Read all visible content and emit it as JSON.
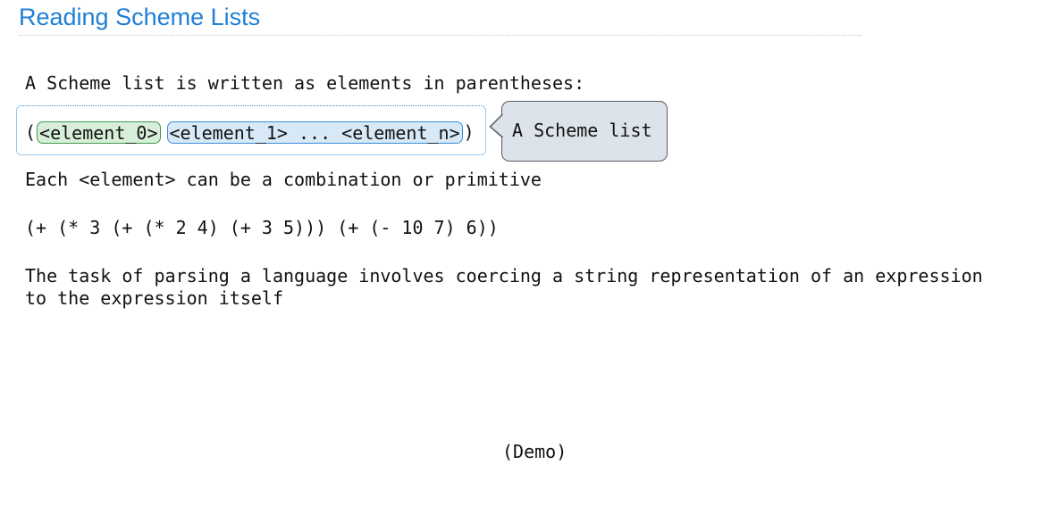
{
  "slide": {
    "title": "Reading Scheme Lists",
    "intro": "A Scheme list is written as elements in parentheses:",
    "list_syntax": {
      "open_paren": "(",
      "first_element": "<element_0>",
      "rest_elements": "<element_1> ... <element_n>",
      "close_paren": ")"
    },
    "callout": "A Scheme list",
    "element_note": "Each <element> can be a combination or primitive",
    "example_expression": "(+ (* 3 (+ (* 2 4) (+ 3 5))) (+ (- 10 7) 6))",
    "parsing_line_1": "The task of parsing a language involves coercing a string representation of an expression",
    "parsing_line_2": "to the expression itself",
    "demo": "(Demo)"
  },
  "colors": {
    "title": "#1f7fd6",
    "first_element_fill": "#d7efd9",
    "first_element_border": "#3d9a4f",
    "rest_elements_fill": "#d7e8f7",
    "rest_elements_border": "#3a8fd6",
    "callout_fill": "#dde3ea"
  }
}
